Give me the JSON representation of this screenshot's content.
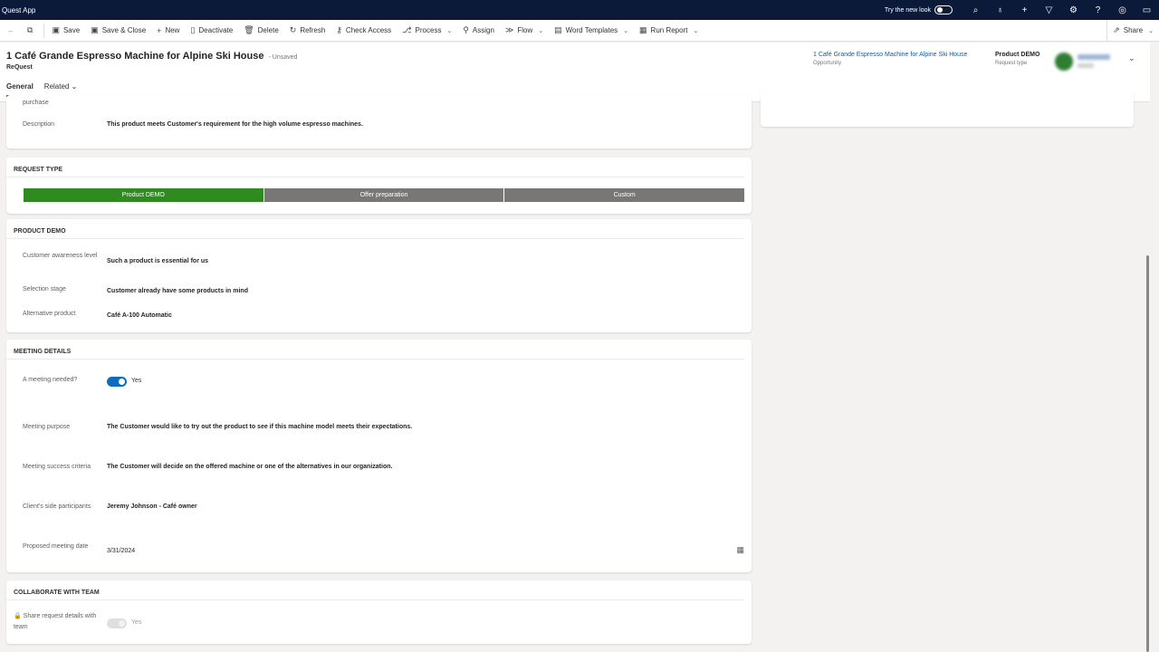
{
  "app": {
    "title": "Quest App",
    "try_new_look": "Try the new look"
  },
  "commands": {
    "save": "Save",
    "save_close": "Save & Close",
    "new": "New",
    "deactivate": "Deactivate",
    "delete": "Delete",
    "refresh": "Refresh",
    "check_access": "Check Access",
    "process": "Process",
    "assign": "Assign",
    "flow": "Flow",
    "word_templates": "Word Templates",
    "run_report": "Run Report",
    "share": "Share"
  },
  "record": {
    "title": "1 Café Grande Espresso Machine for Alpine Ski House",
    "status": "- Unsaved",
    "entity": "ReQuest",
    "tabs": [
      "General",
      "Related"
    ],
    "opportunity": {
      "value": "1 Café Grande Espresso Machine for Alpine Ski House",
      "label": "Opportunity"
    },
    "request_type": {
      "value": "Product DEMO",
      "label": "Request type"
    }
  },
  "top_section": {
    "partial_label": "purchase",
    "description": {
      "label": "Description",
      "value": "This product meets Customer's requirement for the high volume espresso machines."
    }
  },
  "request_type_section": {
    "title": "REQUEST TYPE",
    "stages": [
      "Product DEMO",
      "Offer preparation",
      "Custom"
    ],
    "active_stage": "Product DEMO"
  },
  "product_demo": {
    "title": "PRODUCT DEMO",
    "fields": [
      {
        "label": "Customer awareness level",
        "value": "Such a product is essential for us"
      },
      {
        "label": "Selection stage",
        "value": "Customer already have some products in mind"
      },
      {
        "label": "Alternative product",
        "value": "Café A-100 Automatic"
      }
    ]
  },
  "meeting": {
    "title": "MEETING DETAILS",
    "needed": {
      "label": "A meeting needed?",
      "value": "Yes"
    },
    "purpose": {
      "label": "Meeting purpose",
      "value": "The Customer would like to try out the product to see if this machine model meets their expectations."
    },
    "success": {
      "label": "Meeting success criteria",
      "value": "The Customer will decide on the offered machine or one of the alternatives in our organization."
    },
    "participants": {
      "label": "Client's side participants",
      "value": "Jeremy Johnson - Café owner"
    },
    "date": {
      "label": "Proposed meeting date",
      "value": "3/31/2024"
    }
  },
  "collaborate": {
    "title": "COLLABORATE WITH TEAM",
    "share": {
      "label": "Share request details with team",
      "value": "Yes"
    }
  },
  "colors": {
    "appbar": "#0c1a3a",
    "active_stage": "#2f8a1f",
    "inactive_stage": "#797775",
    "toggle_on": "#0f6cbd",
    "link": "#115ea3"
  }
}
